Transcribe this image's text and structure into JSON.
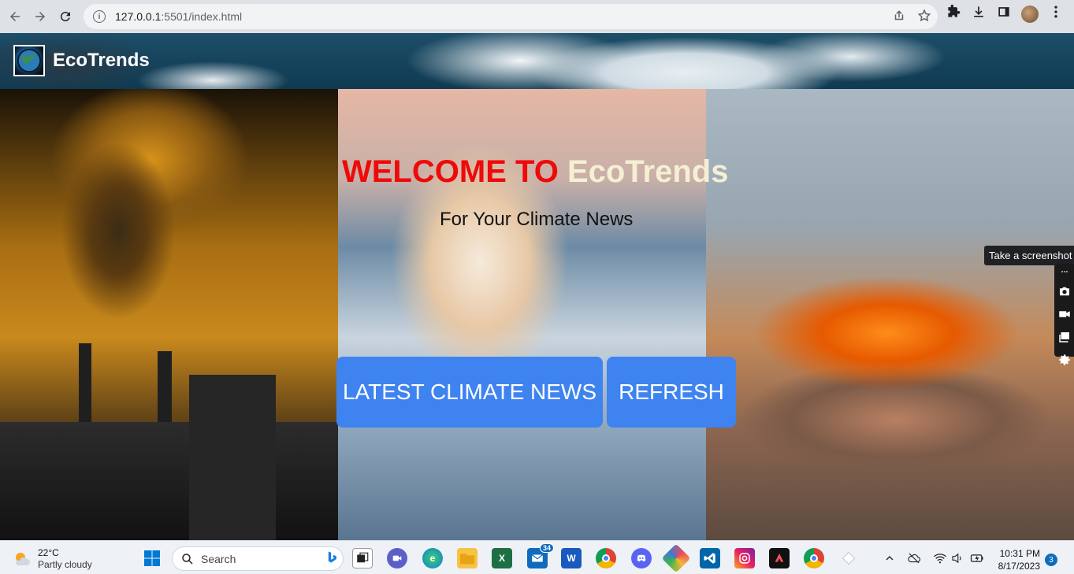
{
  "browser": {
    "url_host": "127.0.0.1",
    "url_path": ":5501/index.html"
  },
  "site": {
    "brand": "EcoTrends",
    "welcome_prefix": "WELCOME TO",
    "welcome_brand": "EcoTrends",
    "tagline": "For Your Climate News",
    "latest_news_button": "LATEST CLIMATE NEWS",
    "refresh_button": "REFRESH"
  },
  "screenshot_tool": {
    "tooltip": "Take a screenshot"
  },
  "taskbar": {
    "temperature": "22°C",
    "condition": "Partly cloudy",
    "search_placeholder": "Search",
    "mail_badge": "34",
    "time": "10:31 PM",
    "date": "8/17/2023",
    "notification_count": "3"
  },
  "colors": {
    "accent_button": "#3f83f0",
    "welcome_red": "#ee0a0a",
    "welcome_cream": "#f5efd3"
  }
}
